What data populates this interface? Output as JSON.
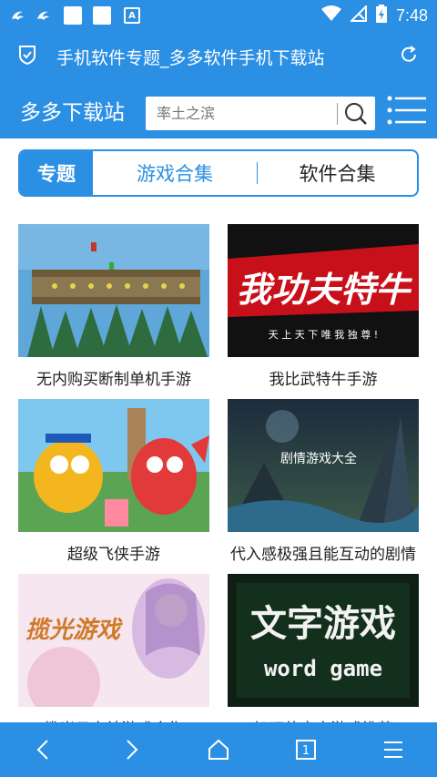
{
  "status_bar": {
    "time": "7:48",
    "notification_box_label": "A"
  },
  "title_bar": {
    "title": "手机软件专题_多多软件手机下载站"
  },
  "header": {
    "brand": "多多下载站",
    "search_placeholder": "率土之滨"
  },
  "tabs": [
    {
      "label": "专题",
      "active": true
    },
    {
      "label": "游戏合集",
      "active": false
    },
    {
      "label": "软件合集",
      "active": false
    }
  ],
  "cards": [
    {
      "caption": "无内购买断制单机手游",
      "thumb_text": ""
    },
    {
      "caption": "我比武特牛手游",
      "thumb_text": "我功夫特牛",
      "thumb_sub": "天 上 天 下 唯 我 独 尊 !"
    },
    {
      "caption": "超级飞侠手游",
      "thumb_text": ""
    },
    {
      "caption": "代入感极强且能互动的剧情",
      "thumb_text": "剧情游戏大全"
    },
    {
      "caption": "揽光日宫结游戏合集",
      "thumb_text": "揽光游戏"
    },
    {
      "caption": "好玩的文字游戏推荐",
      "thumb_text": "文字游戏",
      "thumb_sub": "word game"
    }
  ],
  "bottom_bar": {
    "page_count": "1"
  },
  "colors": {
    "primary": "#2b8fe3",
    "white": "#ffffff"
  }
}
